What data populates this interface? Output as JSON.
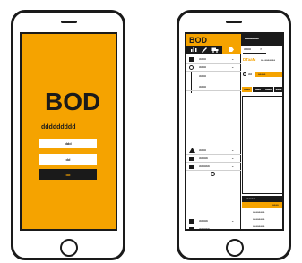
{
  "colors": {
    "accent": "#f5a300",
    "dark": "#1a1a1a",
    "light": "#ffffff"
  },
  "login_screen": {
    "logo_text": "BOD",
    "tagline": "ddddddddd",
    "button_one": "ddd",
    "button_two": "dd",
    "button_three": "dd"
  },
  "app_screen": {
    "logo_text": "BOD",
    "header_title": "aaaaaaaa",
    "toolbar_icons": [
      "chart-icon",
      "pen-icon",
      "truck-icon",
      "tag-icon"
    ],
    "sidebar_items": [
      {
        "icon": "laptop-icon",
        "label": "aaaa"
      },
      {
        "icon": "clock-icon",
        "label": "aaaa"
      },
      {
        "icon": "dot-icon",
        "label": "aaaa"
      },
      {
        "icon": "dot-icon",
        "label": "aaaa"
      },
      {
        "icon": "warning-icon",
        "label": "aaaa"
      },
      {
        "icon": "calendar-icon",
        "label": "aaaaa"
      },
      {
        "icon": "image-icon",
        "label": "aaaaaa"
      }
    ],
    "sidebar_footer_items": [
      {
        "icon": "calendar-icon",
        "label": "aaaaa"
      },
      {
        "icon": "image-icon",
        "label": "aaaaaa"
      }
    ],
    "search_value": "aaaa",
    "panel_title": "DTaaM",
    "panel_value": "aa-aaaaaaa",
    "filter_label": "aa",
    "filter_value": "aaaaa",
    "tabs": [
      "aaaa",
      "aaaa",
      "aaaa",
      "aaaa"
    ],
    "bottom_bar_label": "aaaaaa",
    "bottom_action": "aaaa",
    "list_items": [
      "aaaaaaaa",
      "aaaaaaaa",
      "aaaaaaaa"
    ]
  }
}
